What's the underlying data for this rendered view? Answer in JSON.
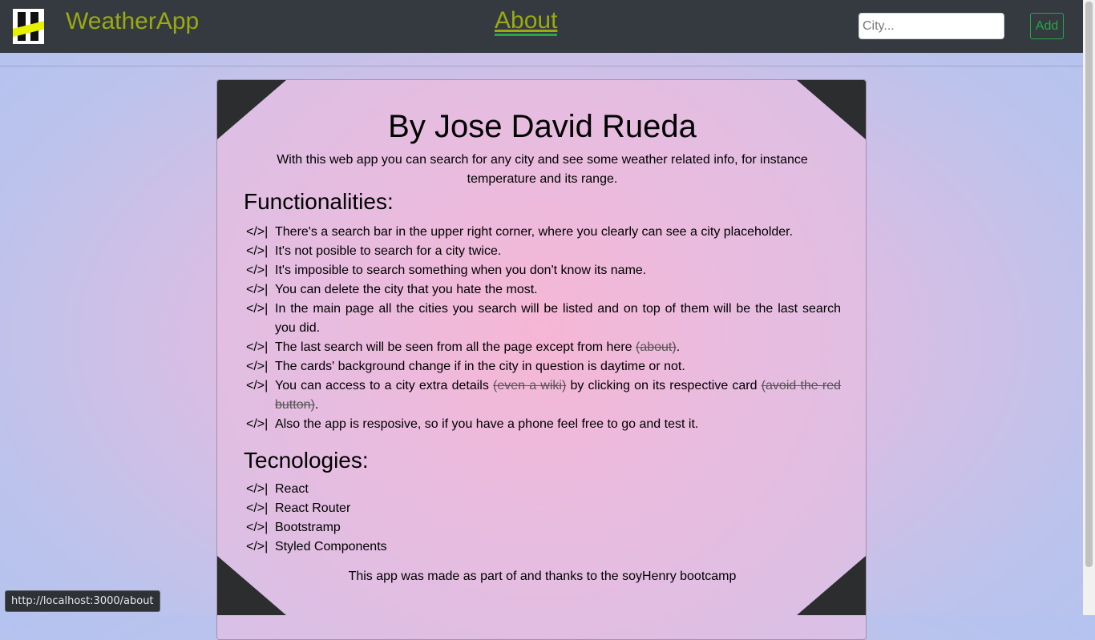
{
  "navbar": {
    "brand": "WeatherApp",
    "about_link": "About",
    "search_placeholder": "City...",
    "add_button": "Add"
  },
  "about": {
    "title": "By Jose David Rueda",
    "intro": "With this web app you can search for any city and see some weather related info, for instance temperature and its range.",
    "functionalities_heading": "Functionalities:",
    "marker": "</>|",
    "functionalities": [
      {
        "text": "There's a search bar in the upper right corner, where you clearly can see a city placeholder."
      },
      {
        "text": "It's not posible to search for a city twice."
      },
      {
        "text": "It's imposible to search something when you don't know its name."
      },
      {
        "text": "You can delete the city that you hate the most."
      },
      {
        "text": "In the main page all the cities you search will be listed and on top of them will be the last search you did."
      },
      {
        "text_a": "The last search will be seen from all the page except from here ",
        "strike_a": "(about)",
        "text_b": "."
      },
      {
        "text": "The cards' background change if in the city in question is daytime or not."
      },
      {
        "text_a": "You can access to a city extra details ",
        "strike_a": "(even a wiki)",
        "text_b": " by clicking on its respective card ",
        "strike_b": "(avoid the red button)",
        "text_c": "."
      },
      {
        "text": "Also the app is resposive, so if you have a phone feel free to go and test it."
      }
    ],
    "technologies_heading": "Tecnologies:",
    "technologies": [
      "React",
      "React Router",
      "Bootstramp",
      "Styled Components"
    ],
    "footer": "This app was made as part of and thanks to the soyHenry bootcamp"
  },
  "status_bar": {
    "url": "http://localhost:3000/about"
  }
}
